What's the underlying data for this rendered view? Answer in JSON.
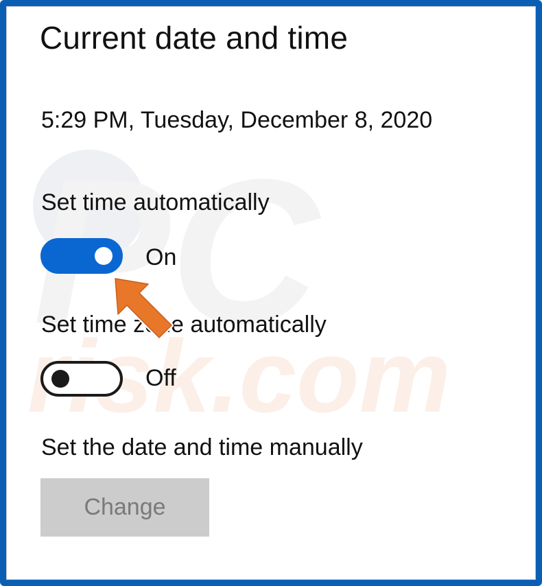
{
  "page": {
    "title": "Current date and time",
    "current_datetime": "5:29 PM, Tuesday, December 8, 2020"
  },
  "settings": {
    "set_time_automatically": {
      "label": "Set time automatically",
      "state": "On",
      "enabled": true
    },
    "set_time_zone_automatically": {
      "label": "Set time zone automatically",
      "state": "Off",
      "enabled": false
    },
    "manual": {
      "label": "Set the date and time manually",
      "button_label": "Change",
      "button_disabled": true
    }
  },
  "watermark": {
    "logo_text": "PC",
    "site_text": "risk.com"
  },
  "colors": {
    "frame_border": "#0a5fb5",
    "toggle_on": "#0a67d2",
    "toggle_off_outline": "#1a1a1a",
    "button_disabled_bg": "#cccccc",
    "button_disabled_text": "#7a7a7a",
    "arrow": "#e8772a"
  },
  "icons": {
    "pointer": "arrow-pointer-icon"
  }
}
